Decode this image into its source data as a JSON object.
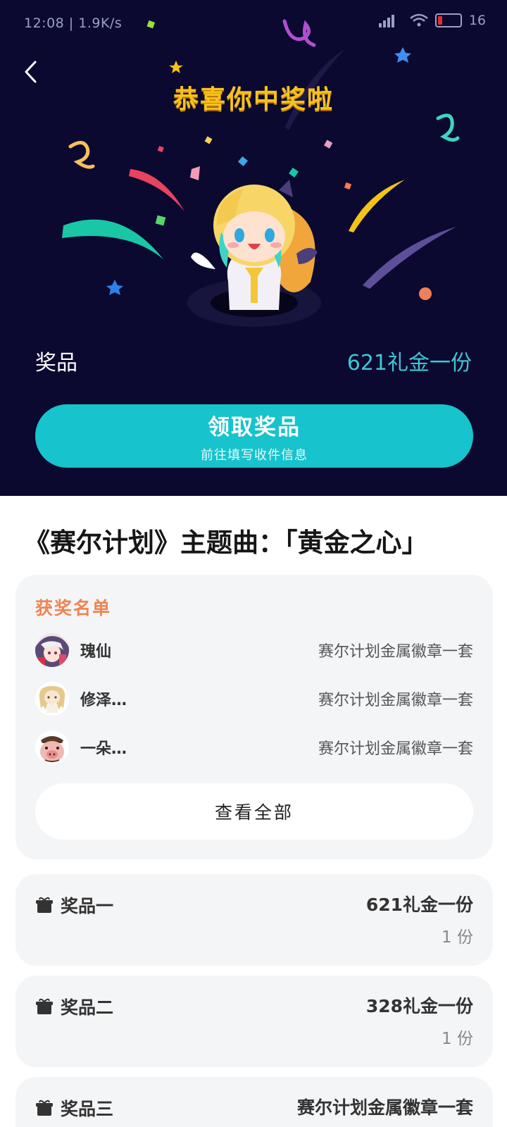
{
  "status_bar": {
    "left": "12:08 | 1.9K/s",
    "battery": "16"
  },
  "hero": {
    "title": "恭喜你中奖啦",
    "prize_label": "奖品",
    "prize_value": "621礼金一份",
    "claim_button": {
      "title": "领取奖品",
      "subtitle": "前往填写收件信息"
    }
  },
  "song_title": "《赛尔计划》主题曲：「黄金之心」",
  "winners": {
    "heading": "获奖名单",
    "items": [
      {
        "name": "瑰仙",
        "prize": "赛尔计划金属徽章一套",
        "avatar": "anime-girl-avatar"
      },
      {
        "name": "修泽…",
        "prize": "赛尔计划金属徽章一套",
        "avatar": "blonde-chibi-avatar"
      },
      {
        "name": "一朵…",
        "prize": "赛尔计划金属徽章一套",
        "avatar": "pig-avatar"
      }
    ],
    "view_all": "查看全部"
  },
  "prizes": [
    {
      "name": "奖品一",
      "value": "621礼金一份",
      "qty": "1 份"
    },
    {
      "name": "奖品二",
      "value": "328礼金一份",
      "qty": "1 份"
    },
    {
      "name": "奖品三",
      "value": "赛尔计划金属徽章一套"
    }
  ],
  "colors": {
    "hero_bg": "#0b0930",
    "accent": "#17c3cc",
    "title_gold": "#f7c21c",
    "winners_heading": "#f08450"
  }
}
